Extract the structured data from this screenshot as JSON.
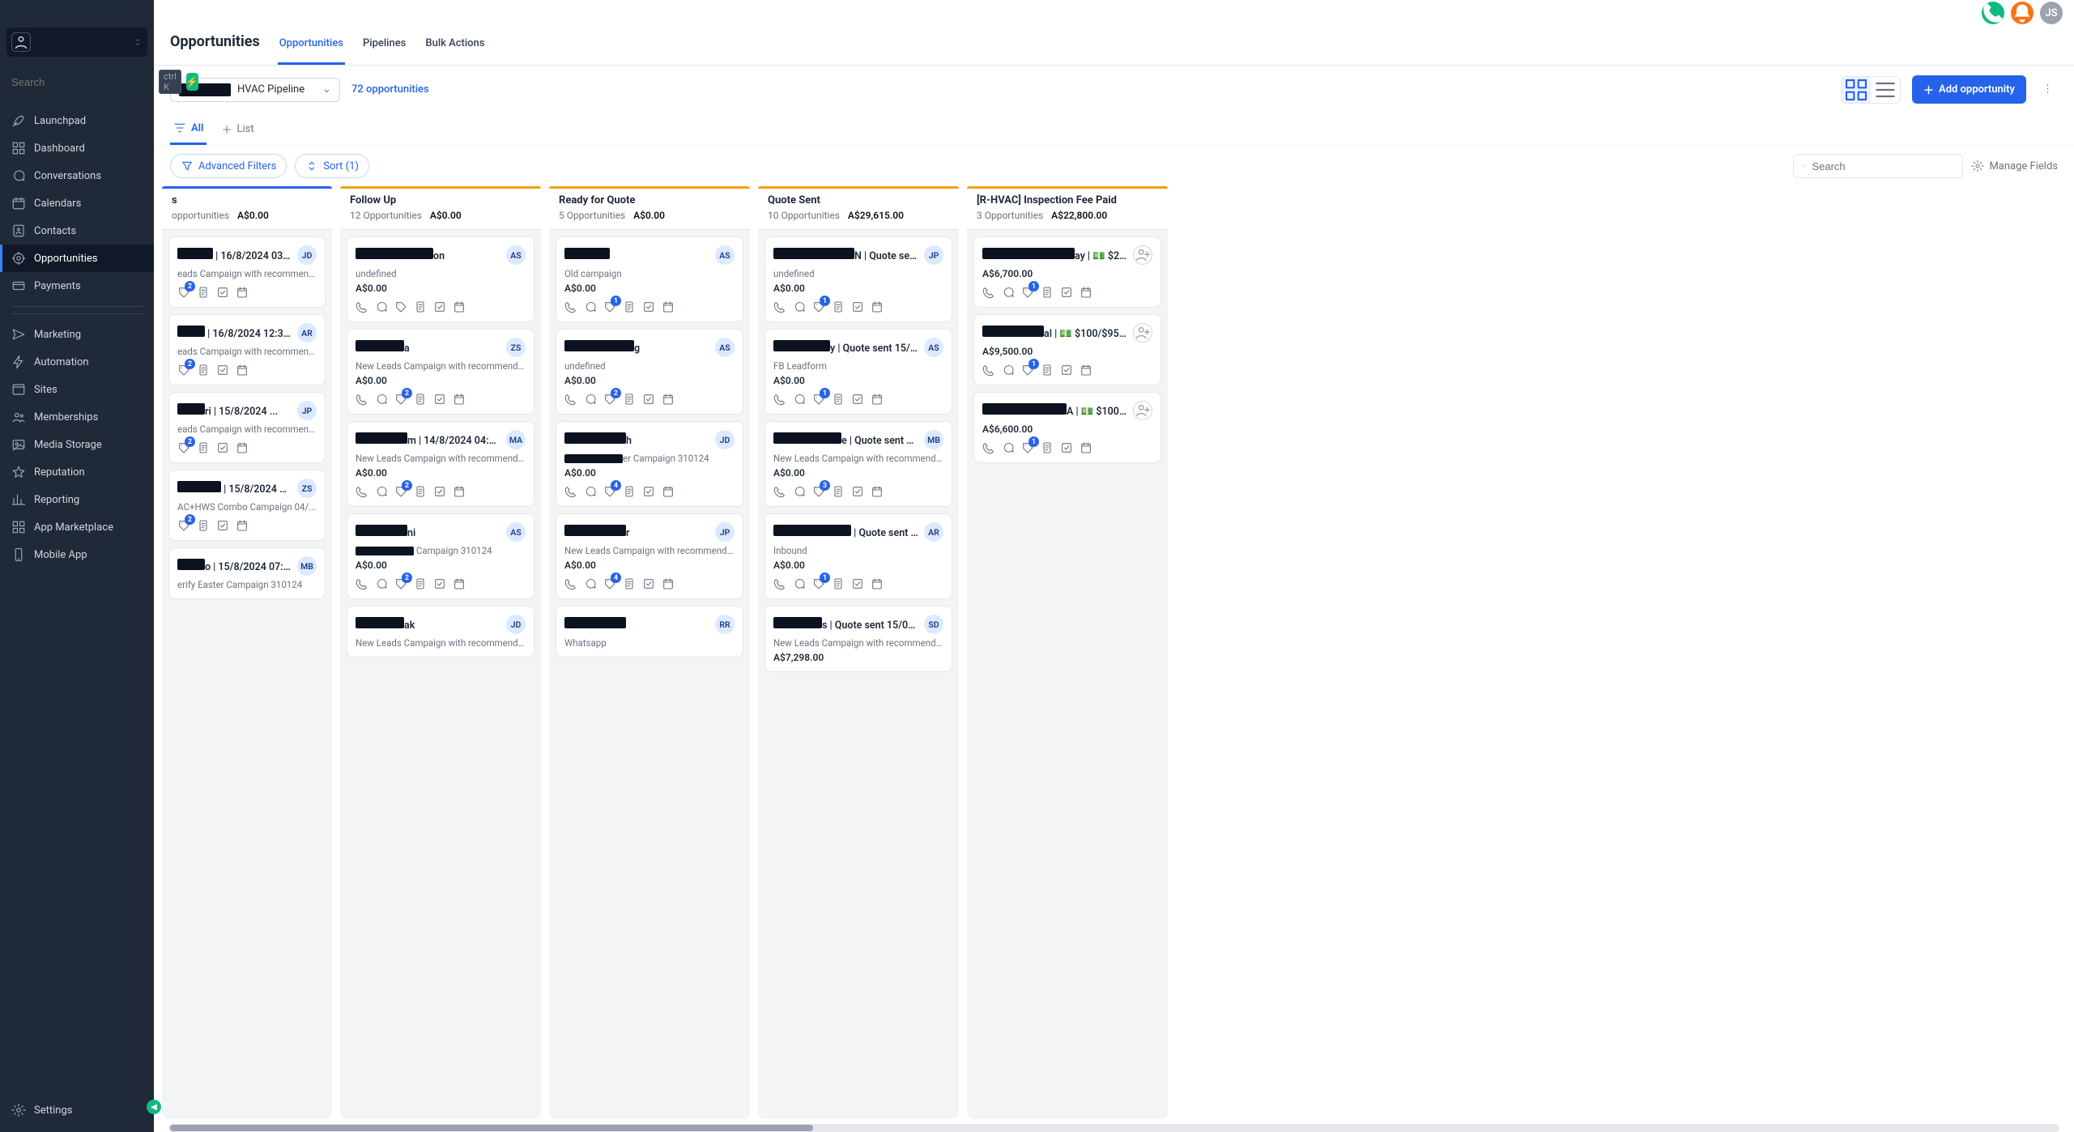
{
  "top": {
    "avatar": "JS"
  },
  "sidebar": {
    "search_placeholder": "Search",
    "kbd": "ctrl K",
    "items": [
      {
        "icon": "rocket",
        "label": "Launchpad"
      },
      {
        "icon": "grid",
        "label": "Dashboard"
      },
      {
        "icon": "chat",
        "label": "Conversations"
      },
      {
        "icon": "calendar",
        "label": "Calendars"
      },
      {
        "icon": "contacts",
        "label": "Contacts"
      },
      {
        "icon": "target",
        "label": "Opportunities",
        "active": true
      },
      {
        "icon": "card",
        "label": "Payments"
      }
    ],
    "items2": [
      {
        "icon": "send",
        "label": "Marketing"
      },
      {
        "icon": "bolt",
        "label": "Automation"
      },
      {
        "icon": "site",
        "label": "Sites"
      },
      {
        "icon": "members",
        "label": "Memberships"
      },
      {
        "icon": "media",
        "label": "Media Storage"
      },
      {
        "icon": "star",
        "label": "Reputation"
      },
      {
        "icon": "chart",
        "label": "Reporting"
      },
      {
        "icon": "apps",
        "label": "App Marketplace"
      },
      {
        "icon": "phone",
        "label": "Mobile App"
      }
    ],
    "settings": "Settings"
  },
  "header": {
    "title": "Opportunities",
    "tabs": [
      "Opportunities",
      "Pipelines",
      "Bulk Actions"
    ],
    "active_tab": 0
  },
  "toolbar": {
    "pipeline_suffix": "HVAC Pipeline",
    "count_label": "72 opportunities",
    "add_label": "Add opportunity",
    "subtab_all": "All",
    "subtab_list": "List",
    "adv_filters": "Advanced Filters",
    "sort": "Sort (1)",
    "search_placeholder": "Search",
    "manage_fields": "Manage Fields"
  },
  "columns": [
    {
      "id": "contacted",
      "title": "s",
      "bar": "#2563eb",
      "sub_left": "opportunities",
      "total": "A$0.00",
      "cards": [
        {
          "name_w": 44,
          "suffix": " | 16/8/2024 03:06 ...",
          "avatar": "JD",
          "source": "eads Campaign with recommende...",
          "value": "",
          "badge": 2,
          "partial": true
        },
        {
          "name_w": 34,
          "suffix": " | 16/8/2024 12:37 A...",
          "avatar": "AR",
          "source": "eads Campaign with recommende...",
          "value": "",
          "badge": 2,
          "partial": true
        },
        {
          "name_w": 34,
          "suffix": "ri | 15/8/2024 ...",
          "avatar": "JP",
          "source": "eads Campaign with recommende...",
          "value": "",
          "badge": 2,
          "partial": true
        },
        {
          "name_w": 54,
          "suffix": " | 15/8/2024 09:...",
          "avatar": "ZS",
          "source": "AC+HWS Combo Campaign 04/...",
          "value": "",
          "badge": 2,
          "partial": true
        },
        {
          "name_w": 34,
          "suffix": "o | 15/8/2024 07:31 ...",
          "avatar": "MB",
          "source": "erify Easter Campaign 310124",
          "value": "",
          "badge": null,
          "partial": true,
          "noicons": true
        }
      ]
    },
    {
      "id": "followup",
      "title": "Follow Up",
      "bar": "#f59e0b",
      "sub_left": "12 Opportunities",
      "total": "A$0.00",
      "cards": [
        {
          "name_w": 96,
          "suffix": "on",
          "avatar": "AS",
          "source": "undefined",
          "value": "A$0.00",
          "badge": null
        },
        {
          "name_w": 60,
          "suffix": "a",
          "avatar": "ZS",
          "source": "New Leads Campaign with recommende...",
          "value": "A$0.00",
          "badge": 2
        },
        {
          "name_w": 64,
          "suffix": "m | 14/8/2024 04:26...",
          "avatar": "MA",
          "source": "New Leads Campaign with recommende...",
          "value": "A$0.00",
          "badge": 2
        },
        {
          "name_w": 64,
          "suffix": "ni",
          "avatar": "AS",
          "source_prefix": true,
          "source": " Campaign 310124",
          "value": "A$0.00",
          "badge": 2
        },
        {
          "name_w": 60,
          "suffix": "ak",
          "avatar": "JD",
          "source": "New Leads Campaign with recommende...",
          "value": "",
          "badge": null,
          "noicons": true
        }
      ]
    },
    {
      "id": "ready",
      "title": "Ready for Quote",
      "bar": "#f59e0b",
      "sub_left": "5 Opportunities",
      "total": "A$0.00",
      "cards": [
        {
          "name_w": 56,
          "suffix": "",
          "avatar": "AS",
          "source": "Old campaign",
          "value": "A$0.00",
          "badge": 1
        },
        {
          "name_w": 86,
          "suffix": "g",
          "avatar": "AS",
          "source": "undefined",
          "value": "A$0.00",
          "badge": 2
        },
        {
          "name_w": 76,
          "suffix": "h",
          "avatar": "JD",
          "source_prefix": true,
          "source": "er Campaign 310124",
          "value": "A$0.00",
          "badge": 4
        },
        {
          "name_w": 76,
          "suffix": "r",
          "avatar": "JP",
          "source": "New Leads Campaign with recommende...",
          "value": "A$0.00",
          "badge": 4
        },
        {
          "name_w": 76,
          "suffix": "",
          "avatar": "RR",
          "source": "Whatsapp",
          "value": "",
          "badge": null,
          "noicons": true
        }
      ]
    },
    {
      "id": "sent",
      "title": "Quote Sent",
      "bar": "#f59e0b",
      "sub_left": "10 Opportunities",
      "total": "A$29,615.00",
      "cards": [
        {
          "name_w": 100,
          "suffix": "N | Quote sent...",
          "avatar": "JP",
          "source": "undefined",
          "value": "A$0.00",
          "badge": 1
        },
        {
          "name_w": 70,
          "suffix": "y | Quote sent 15/0...",
          "avatar": "AS",
          "source": "FB Leadform",
          "value": "A$0.00",
          "badge": 1
        },
        {
          "name_w": 84,
          "suffix": "e | Quote sent 15/...",
          "avatar": "MB",
          "source": "New Leads Campaign with recommende...",
          "value": "A$0.00",
          "badge": 3
        },
        {
          "name_w": 96,
          "suffix": " | Quote sent 1...",
          "avatar": "AR",
          "source": "Inbound",
          "value": "A$0.00",
          "badge": 1
        },
        {
          "name_w": 60,
          "suffix": "s | Quote sent 15/08/2...",
          "avatar": "SD",
          "source": "New Leads Campaign with recommende...",
          "value": "A$7,298.00",
          "badge": null,
          "noicons": true
        }
      ]
    },
    {
      "id": "paid",
      "title": "[R-HVAC] Inspection Fee Paid",
      "bar": "#f59e0b",
      "sub_left": "3 Opportunities",
      "total": "A$22,800.00",
      "cards": [
        {
          "name_w": 114,
          "suffix": "ay | 💵 $20...",
          "avatar": "outline",
          "source": "",
          "value": "A$6,700.00",
          "badge": 1
        },
        {
          "name_w": 76,
          "suffix": "al | 💵 $100/$9500",
          "avatar": "outline",
          "source": "",
          "value": "A$9,500.00",
          "badge": 1
        },
        {
          "name_w": 104,
          "suffix": "A | 💵 $100/$...",
          "avatar": "outline",
          "source": "",
          "value": "A$6,600.00",
          "badge": 1
        }
      ]
    }
  ]
}
